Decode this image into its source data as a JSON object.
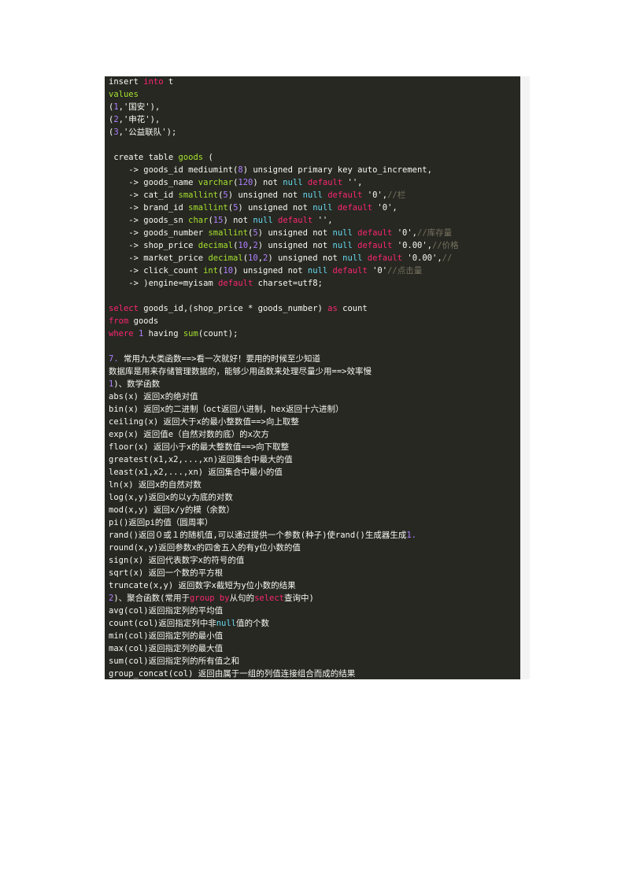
{
  "colors": {
    "background": "#272822",
    "keyword": "#f92672",
    "type": "#a6e22e",
    "number": "#ae81ff",
    "comment": "#75715e",
    "text": "#f8f8f2"
  },
  "code_lines": [
    [
      [
        "insert ",
        "w"
      ],
      [
        "into",
        "k"
      ],
      [
        " t",
        "w"
      ]
    ],
    [
      [
        "values",
        "g"
      ]
    ],
    [
      [
        "(",
        "w"
      ],
      [
        "1",
        "p"
      ],
      [
        ",'国安'),",
        "w"
      ]
    ],
    [
      [
        "(",
        "w"
      ],
      [
        "2",
        "p"
      ],
      [
        ",'申花'),",
        "w"
      ]
    ],
    [
      [
        "(",
        "w"
      ],
      [
        "3",
        "p"
      ],
      [
        ",'公益联队');",
        "w"
      ]
    ],
    [],
    [
      [
        " create table ",
        "w"
      ],
      [
        "goods",
        "g"
      ],
      [
        " (",
        "w"
      ]
    ],
    [
      [
        "    -> goods_id mediumint(",
        "w"
      ],
      [
        "8",
        "p"
      ],
      [
        ") unsigned primary key auto_increment,",
        "w"
      ]
    ],
    [
      [
        "    -> goods_name ",
        "w"
      ],
      [
        "varchar",
        "g"
      ],
      [
        "(",
        "w"
      ],
      [
        "120",
        "p"
      ],
      [
        ") not ",
        "w"
      ],
      [
        "null",
        "b"
      ],
      [
        " ",
        "w"
      ],
      [
        "default",
        "k"
      ],
      [
        " '',",
        "w"
      ]
    ],
    [
      [
        "    -> cat_id ",
        "w"
      ],
      [
        "smallint",
        "g"
      ],
      [
        "(",
        "w"
      ],
      [
        "5",
        "p"
      ],
      [
        ") unsigned not ",
        "w"
      ],
      [
        "null",
        "b"
      ],
      [
        " ",
        "w"
      ],
      [
        "default",
        "k"
      ],
      [
        " '0',",
        "w"
      ],
      [
        "//栏",
        "c"
      ]
    ],
    [
      [
        "    -> brand_id ",
        "w"
      ],
      [
        "smallint",
        "g"
      ],
      [
        "(",
        "w"
      ],
      [
        "5",
        "p"
      ],
      [
        ") unsigned not ",
        "w"
      ],
      [
        "null",
        "b"
      ],
      [
        " ",
        "w"
      ],
      [
        "default",
        "k"
      ],
      [
        " '0',",
        "w"
      ]
    ],
    [
      [
        "    -> goods_sn ",
        "w"
      ],
      [
        "char",
        "g"
      ],
      [
        "(",
        "w"
      ],
      [
        "15",
        "p"
      ],
      [
        ") not ",
        "w"
      ],
      [
        "null",
        "b"
      ],
      [
        " ",
        "w"
      ],
      [
        "default",
        "k"
      ],
      [
        " '',",
        "w"
      ]
    ],
    [
      [
        "    -> goods_number ",
        "w"
      ],
      [
        "smallint",
        "g"
      ],
      [
        "(",
        "w"
      ],
      [
        "5",
        "p"
      ],
      [
        ") unsigned not ",
        "w"
      ],
      [
        "null",
        "b"
      ],
      [
        " ",
        "w"
      ],
      [
        "default",
        "k"
      ],
      [
        " '0',",
        "w"
      ],
      [
        "//库存量",
        "c"
      ]
    ],
    [
      [
        "    -> shop_price ",
        "w"
      ],
      [
        "decimal",
        "g"
      ],
      [
        "(",
        "w"
      ],
      [
        "10",
        "p"
      ],
      [
        ",",
        "w"
      ],
      [
        "2",
        "p"
      ],
      [
        ") unsigned not ",
        "w"
      ],
      [
        "null",
        "b"
      ],
      [
        " ",
        "w"
      ],
      [
        "default",
        "k"
      ],
      [
        " '0.00',",
        "w"
      ],
      [
        "//价格",
        "c"
      ]
    ],
    [
      [
        "    -> market_price ",
        "w"
      ],
      [
        "decimal",
        "g"
      ],
      [
        "(",
        "w"
      ],
      [
        "10",
        "p"
      ],
      [
        ",",
        "w"
      ],
      [
        "2",
        "p"
      ],
      [
        ") unsigned not ",
        "w"
      ],
      [
        "null",
        "b"
      ],
      [
        " ",
        "w"
      ],
      [
        "default",
        "k"
      ],
      [
        " '0.00',",
        "w"
      ],
      [
        "//",
        "c"
      ]
    ],
    [
      [
        "    -> click_count ",
        "w"
      ],
      [
        "int",
        "g"
      ],
      [
        "(",
        "w"
      ],
      [
        "10",
        "p"
      ],
      [
        ") unsigned not ",
        "w"
      ],
      [
        "null",
        "b"
      ],
      [
        " ",
        "w"
      ],
      [
        "default",
        "k"
      ],
      [
        " '0'",
        "w"
      ],
      [
        "//点击量",
        "c"
      ]
    ],
    [
      [
        "    -> )engine=myisam ",
        "w"
      ],
      [
        "default",
        "k"
      ],
      [
        " charset=utf8;",
        "w"
      ]
    ],
    [],
    [
      [
        "select",
        "k"
      ],
      [
        " goods_id,(shop_price * goods_number) ",
        "w"
      ],
      [
        "as",
        "k"
      ],
      [
        " count",
        "w"
      ]
    ],
    [
      [
        "from",
        "k"
      ],
      [
        " goods",
        "w"
      ]
    ],
    [
      [
        "where",
        "k"
      ],
      [
        " ",
        "w"
      ],
      [
        "1",
        "p"
      ],
      [
        " having ",
        "w"
      ],
      [
        "sum",
        "g"
      ],
      [
        "(count);",
        "w"
      ]
    ],
    [],
    [
      [
        "7.",
        "p"
      ],
      [
        " 常用九大类函数==>看一次就好！要用的时候至少知道",
        "w"
      ]
    ],
    [
      [
        "数据库是用来存储管理数据的，能够少用函数来处理尽量少用==>效率慢",
        "w"
      ]
    ],
    [
      [
        "1",
        "p"
      ],
      [
        ")、数学函数",
        "w"
      ]
    ],
    [
      [
        "abs(x) 返回x的绝对值",
        "w"
      ]
    ],
    [
      [
        "bin(x) 返回x的二进制（oct返回八进制，hex返回十六进制）",
        "w"
      ]
    ],
    [
      [
        "ceiling(x) 返回大于x的最小整数值==>向上取整",
        "w"
      ]
    ],
    [
      [
        "exp(x) 返回值e（自然对数的底）的x次方",
        "w"
      ]
    ],
    [
      [
        "floor(x) 返回小于x的最大整数值==>向下取整",
        "w"
      ]
    ],
    [
      [
        "greatest(x1,x2,...,xn)返回集合中最大的值",
        "w"
      ]
    ],
    [
      [
        "least(x1,x2,...,xn) 返回集合中最小的值",
        "w"
      ]
    ],
    [
      [
        "ln(x) 返回x的自然对数",
        "w"
      ]
    ],
    [
      [
        "log(x,y)返回x的以y为底的对数",
        "w"
      ]
    ],
    [
      [
        "mod(x,y) 返回x/y的模（余数）",
        "w"
      ]
    ],
    [
      [
        "pi()返回pi的值（圆周率）",
        "w"
      ]
    ],
    [
      [
        "rand()返回０或１的随机值,可以通过提供一个参数(种子)使rand()生成器生成",
        "w"
      ],
      [
        "1.",
        "p"
      ]
    ],
    [
      [
        "round(x,y)返回参数x的四舍五入的有y位小数的值",
        "w"
      ]
    ],
    [
      [
        "sign(x) 返回代表数字x的符号的值",
        "w"
      ]
    ],
    [
      [
        "sqrt(x) 返回一个数的平方根",
        "w"
      ]
    ],
    [
      [
        "truncate(x,y) 返回数字x截短为y位小数的结果",
        "w"
      ]
    ],
    [
      [
        "2",
        "p"
      ],
      [
        ")、聚合函数(常用于",
        "w"
      ],
      [
        "group by",
        "k"
      ],
      [
        "从句的",
        "w"
      ],
      [
        "select",
        "k"
      ],
      [
        "查询中)",
        "w"
      ]
    ],
    [
      [
        "avg(col)返回指定列的平均值",
        "w"
      ]
    ],
    [
      [
        "count(col)返回指定列中非",
        "w"
      ],
      [
        "null",
        "b"
      ],
      [
        "值的个数",
        "w"
      ]
    ],
    [
      [
        "min(col)返回指定列的最小值",
        "w"
      ]
    ],
    [
      [
        "max(col)返回指定列的最大值",
        "w"
      ]
    ],
    [
      [
        "sum(col)返回指定列的所有值之和",
        "w"
      ]
    ],
    [
      [
        "group_concat(col) 返回由属于一组的列值连接组合而成的结果",
        "w"
      ]
    ]
  ]
}
